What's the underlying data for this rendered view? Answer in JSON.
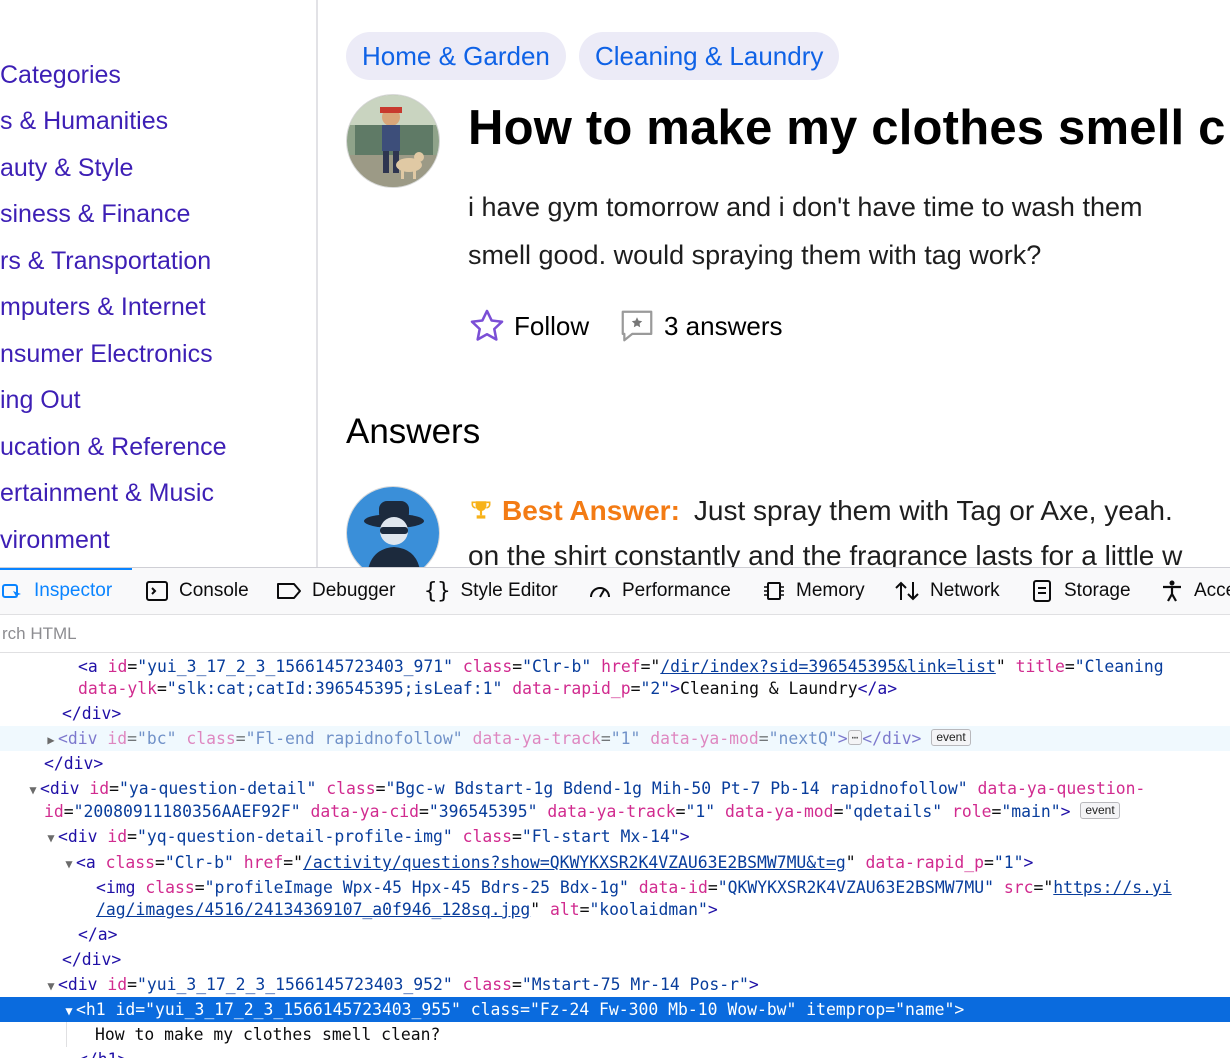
{
  "sidebar": {
    "items": [
      "Categories",
      "s & Humanities",
      "auty & Style",
      "siness & Finance",
      "rs & Transportation",
      "mputers & Internet",
      "nsumer Electronics",
      "ing Out",
      "ucation & Reference",
      "ertainment & Music",
      "vironment"
    ]
  },
  "breadcrumbs": [
    "Home & Garden",
    "Cleaning & Laundry"
  ],
  "question": {
    "title": "How to make my clothes smell c",
    "body_line1": "i have gym tomorrow and i don't have time to wash them",
    "body_line2": "smell good. would spraying them with tag work?",
    "follow_label": "Follow",
    "answers_count": "3 answers"
  },
  "answers": {
    "heading": "Answers",
    "best_label": "Best Answer:",
    "best_text": "Just spray them with Tag or Axe, yeah.",
    "best_text_line2": "on the shirt constantly and the fragrance lasts for a little w"
  },
  "colors": {
    "link": "#3d1fb5",
    "crumb_text": "#0f62e6",
    "best_answer": "#f37b14",
    "devtools_accent": "#0a84ff",
    "selected_row": "#0a6bde"
  },
  "devtools": {
    "tabs": [
      {
        "label": "Inspector",
        "icon": "inspector-icon"
      },
      {
        "label": "Console",
        "icon": "console-icon"
      },
      {
        "label": "Debugger",
        "icon": "debugger-icon"
      },
      {
        "label": "Style Editor",
        "icon": "style-editor-icon"
      },
      {
        "label": "Performance",
        "icon": "performance-icon"
      },
      {
        "label": "Memory",
        "icon": "memory-icon"
      },
      {
        "label": "Network",
        "icon": "network-icon"
      },
      {
        "label": "Storage",
        "icon": "storage-icon"
      },
      {
        "label": "Acce",
        "icon": "accessibility-icon"
      }
    ],
    "search_placeholder": "rch HTML",
    "tree": {
      "r1": {
        "id_val": "\"yui_3_17_2_3_1566145723403_971\"",
        "class_val": "\"Clr-b\"",
        "href_val": "/dir/index?sid=396545395&link=list",
        "title_val": "\"Cleaning"
      },
      "r2": {
        "ylk_val": "\"slk:cat;catId:396545395;isLeaf:1\"",
        "rapid_val": "\"2\"",
        "text": "Cleaning & Laundry"
      },
      "r4": {
        "id_val": "\"bc\"",
        "class_val": "\"Fl-end rapidnofollow\"",
        "track_val": "\"1\"",
        "mod_val": "\"nextQ\"",
        "badge": "event"
      },
      "r6": {
        "id_val": "\"ya-question-detail\"",
        "class_val": "\"Bgc-w Bdstart-1g Bdend-1g Mih-50 Pt-7 Pb-14 rapidnofollow\"",
        "attr_q": "data-ya-question-"
      },
      "r7": {
        "id_val": "\"20080911180356AAEF92F\"",
        "cid_val": "\"396545395\"",
        "track_val": "\"1\"",
        "mod_val": "\"qdetails\"",
        "role_val": "\"main\"",
        "badge": "event"
      },
      "r8": {
        "id_val": "\"yq-question-detail-profile-img\"",
        "class_val": "\"Fl-start Mx-14\""
      },
      "r9": {
        "class_val": "\"Clr-b\"",
        "href_val": "/activity/questions?show=QKWYKXSR2K4VZAU63E2BSMW7MU&t=g",
        "rapid_val": "\"1\""
      },
      "r10": {
        "class_val": "\"profileImage Wpx-45 Hpx-45 Bdrs-25 Bdx-1g\"",
        "dataid_val": "\"QKWYKXSR2K4VZAU63E2BSMW7MU\"",
        "src_val": "https://s.yi"
      },
      "r11": {
        "src_val2": "/ag/images/4516/24134369107_a0f946_128sq.jpg",
        "alt_val": "\"koolaidman\""
      },
      "r14": {
        "id_val": "\"yui_3_17_2_3_1566145723403_952\"",
        "class_val": "\"Mstart-75 Mr-14 Pos-r\""
      },
      "r15": {
        "id_val": "\"yui_3_17_2_3_1566145723403_955\"",
        "class_val": "\"Fz-24 Fw-300 Mb-10 Wow-bw\"",
        "prop_val": "\"name\""
      },
      "r16": {
        "text": "How to make my clothes smell clean?"
      }
    }
  }
}
